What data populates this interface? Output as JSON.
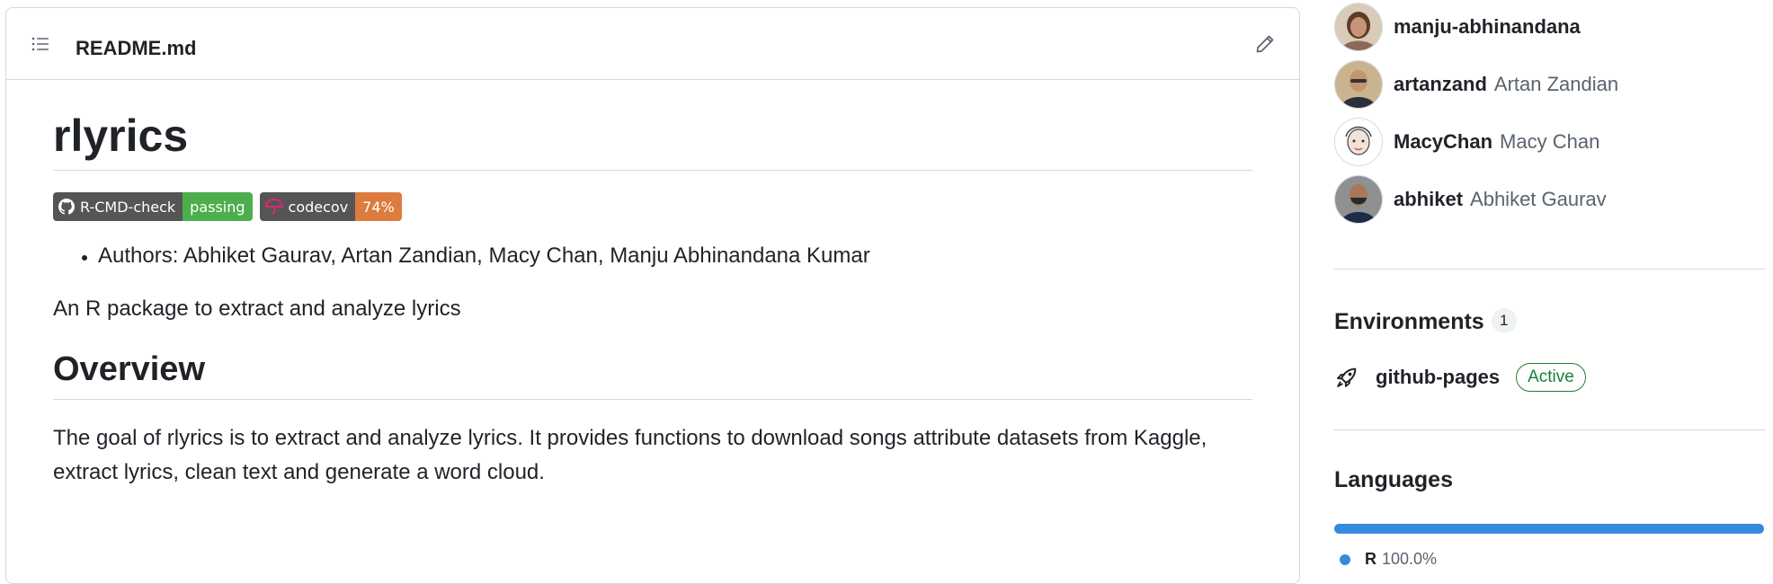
{
  "readme": {
    "filename": "README.md",
    "title": "rlyrics",
    "badges": [
      {
        "label": "R-CMD-check",
        "value": "passing",
        "color": "#4cae4c",
        "icon": "github-icon"
      },
      {
        "label": "codecov",
        "value": "74%",
        "color": "#de7b3f",
        "icon": "codecov-umbrella-icon"
      }
    ],
    "authors_line": "Authors: Abhiket Gaurav, Artan Zandian, Macy Chan, Manju Abhinandana Kumar",
    "description": "An R package to extract and analyze lyrics",
    "overview_heading": "Overview",
    "overview_text": "The goal of rlyrics is to extract and analyze lyrics. It provides functions to download songs attribute datasets from Kaggle, extract lyrics, clean text and generate a word cloud."
  },
  "contributors": [
    {
      "login": "manju-abhinandana",
      "name": ""
    },
    {
      "login": "artanzand",
      "name": "Artan Zandian"
    },
    {
      "login": "MacyChan",
      "name": "Macy Chan"
    },
    {
      "login": "abhiket",
      "name": "Abhiket Gaurav"
    }
  ],
  "environments": {
    "title": "Environments",
    "count": "1",
    "items": [
      {
        "name": "github-pages",
        "status": "Active"
      }
    ]
  },
  "languages": {
    "title": "Languages",
    "items": [
      {
        "name": "R",
        "percent": "100.0%",
        "share": 1.0,
        "color": "#358ae0"
      }
    ]
  }
}
